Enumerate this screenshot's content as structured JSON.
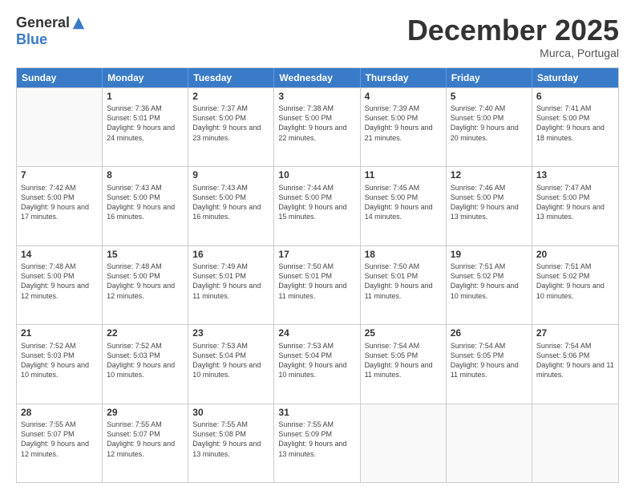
{
  "logo": {
    "general": "General",
    "blue": "Blue"
  },
  "title": "December 2025",
  "location": "Murca, Portugal",
  "days": [
    "Sunday",
    "Monday",
    "Tuesday",
    "Wednesday",
    "Thursday",
    "Friday",
    "Saturday"
  ],
  "rows": [
    [
      {
        "day": "",
        "empty": true
      },
      {
        "day": "1",
        "sunrise": "7:36 AM",
        "sunset": "5:01 PM",
        "daylight": "9 hours and 24 minutes."
      },
      {
        "day": "2",
        "sunrise": "7:37 AM",
        "sunset": "5:00 PM",
        "daylight": "9 hours and 23 minutes."
      },
      {
        "day": "3",
        "sunrise": "7:38 AM",
        "sunset": "5:00 PM",
        "daylight": "9 hours and 22 minutes."
      },
      {
        "day": "4",
        "sunrise": "7:39 AM",
        "sunset": "5:00 PM",
        "daylight": "9 hours and 21 minutes."
      },
      {
        "day": "5",
        "sunrise": "7:40 AM",
        "sunset": "5:00 PM",
        "daylight": "9 hours and 20 minutes."
      },
      {
        "day": "6",
        "sunrise": "7:41 AM",
        "sunset": "5:00 PM",
        "daylight": "9 hours and 18 minutes."
      }
    ],
    [
      {
        "day": "7",
        "sunrise": "7:42 AM",
        "sunset": "5:00 PM",
        "daylight": "9 hours and 17 minutes."
      },
      {
        "day": "8",
        "sunrise": "7:43 AM",
        "sunset": "5:00 PM",
        "daylight": "9 hours and 16 minutes."
      },
      {
        "day": "9",
        "sunrise": "7:43 AM",
        "sunset": "5:00 PM",
        "daylight": "9 hours and 16 minutes."
      },
      {
        "day": "10",
        "sunrise": "7:44 AM",
        "sunset": "5:00 PM",
        "daylight": "9 hours and 15 minutes."
      },
      {
        "day": "11",
        "sunrise": "7:45 AM",
        "sunset": "5:00 PM",
        "daylight": "9 hours and 14 minutes."
      },
      {
        "day": "12",
        "sunrise": "7:46 AM",
        "sunset": "5:00 PM",
        "daylight": "9 hours and 13 minutes."
      },
      {
        "day": "13",
        "sunrise": "7:47 AM",
        "sunset": "5:00 PM",
        "daylight": "9 hours and 13 minutes."
      }
    ],
    [
      {
        "day": "14",
        "sunrise": "7:48 AM",
        "sunset": "5:00 PM",
        "daylight": "9 hours and 12 minutes."
      },
      {
        "day": "15",
        "sunrise": "7:48 AM",
        "sunset": "5:00 PM",
        "daylight": "9 hours and 12 minutes."
      },
      {
        "day": "16",
        "sunrise": "7:49 AM",
        "sunset": "5:01 PM",
        "daylight": "9 hours and 11 minutes."
      },
      {
        "day": "17",
        "sunrise": "7:50 AM",
        "sunset": "5:01 PM",
        "daylight": "9 hours and 11 minutes."
      },
      {
        "day": "18",
        "sunrise": "7:50 AM",
        "sunset": "5:01 PM",
        "daylight": "9 hours and 11 minutes."
      },
      {
        "day": "19",
        "sunrise": "7:51 AM",
        "sunset": "5:02 PM",
        "daylight": "9 hours and 10 minutes."
      },
      {
        "day": "20",
        "sunrise": "7:51 AM",
        "sunset": "5:02 PM",
        "daylight": "9 hours and 10 minutes."
      }
    ],
    [
      {
        "day": "21",
        "sunrise": "7:52 AM",
        "sunset": "5:03 PM",
        "daylight": "9 hours and 10 minutes."
      },
      {
        "day": "22",
        "sunrise": "7:52 AM",
        "sunset": "5:03 PM",
        "daylight": "9 hours and 10 minutes."
      },
      {
        "day": "23",
        "sunrise": "7:53 AM",
        "sunset": "5:04 PM",
        "daylight": "9 hours and 10 minutes."
      },
      {
        "day": "24",
        "sunrise": "7:53 AM",
        "sunset": "5:04 PM",
        "daylight": "9 hours and 10 minutes."
      },
      {
        "day": "25",
        "sunrise": "7:54 AM",
        "sunset": "5:05 PM",
        "daylight": "9 hours and 11 minutes."
      },
      {
        "day": "26",
        "sunrise": "7:54 AM",
        "sunset": "5:05 PM",
        "daylight": "9 hours and 11 minutes."
      },
      {
        "day": "27",
        "sunrise": "7:54 AM",
        "sunset": "5:06 PM",
        "daylight": "9 hours and 11 minutes."
      }
    ],
    [
      {
        "day": "28",
        "sunrise": "7:55 AM",
        "sunset": "5:07 PM",
        "daylight": "9 hours and 12 minutes."
      },
      {
        "day": "29",
        "sunrise": "7:55 AM",
        "sunset": "5:07 PM",
        "daylight": "9 hours and 12 minutes."
      },
      {
        "day": "30",
        "sunrise": "7:55 AM",
        "sunset": "5:08 PM",
        "daylight": "9 hours and 13 minutes."
      },
      {
        "day": "31",
        "sunrise": "7:55 AM",
        "sunset": "5:09 PM",
        "daylight": "9 hours and 13 minutes."
      },
      {
        "day": "",
        "empty": true
      },
      {
        "day": "",
        "empty": true
      },
      {
        "day": "",
        "empty": true
      }
    ]
  ]
}
